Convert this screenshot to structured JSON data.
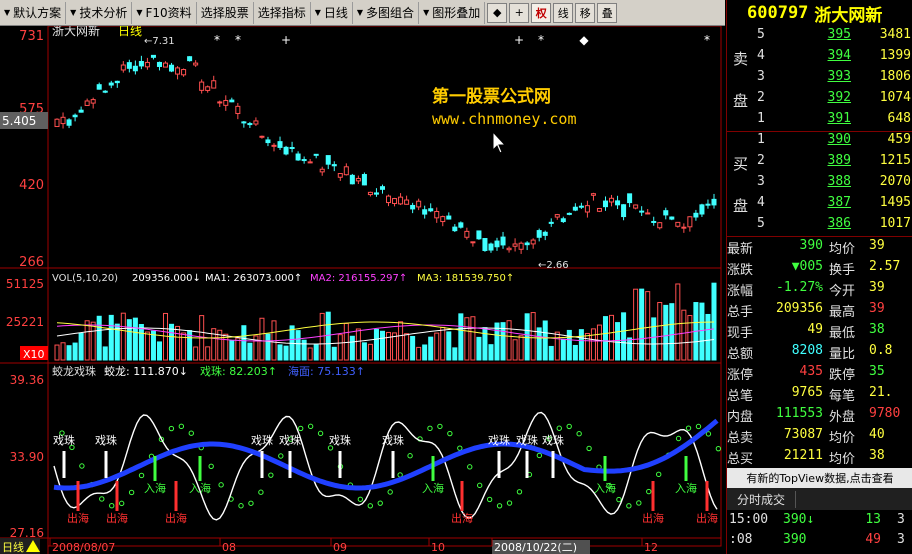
{
  "menu": {
    "items": [
      {
        "label": "默认方案",
        "arrow": "▼"
      },
      {
        "label": "技术分析",
        "arrow": "▼"
      },
      {
        "label": "F10资料",
        "arrow": "▼"
      },
      {
        "label": "选择股票",
        "arrow": ""
      },
      {
        "label": "选择指标",
        "arrow": ""
      },
      {
        "label": "日线",
        "arrow": "▼"
      },
      {
        "label": "多图组合",
        "arrow": "▼"
      },
      {
        "label": "图形叠加",
        "arrow": "▼"
      }
    ],
    "tools": [
      "◆",
      "+",
      "权",
      "线",
      "移",
      "叠"
    ]
  },
  "chart": {
    "title": "浙大网新",
    "period": "日线",
    "max_price_label": "7.31",
    "min_price_label": "2.66",
    "current_price_tag": "5.405",
    "price_axis": [
      "731",
      "575",
      "420",
      "266"
    ],
    "vol_header": {
      "label": "VOL(5,10,20)",
      "vol": "209356.000↓",
      "ma1": "MA1: 263073.000↑",
      "ma2": "MA2: 216155.297↑",
      "ma3": "MA3: 181539.750↑"
    },
    "vol_axis": [
      "51125",
      "25221",
      "X10"
    ],
    "ind_header": {
      "label": "蛟龙戏珠",
      "jl": "蛟龙: 111.870↓",
      "xz": "戏珠: 82.203↑",
      "hm": "海面: 75.133↑"
    },
    "ind_axis": [
      "39.36",
      "33.90",
      "27.16"
    ],
    "signal_labels": {
      "xizhu": "戏珠",
      "ruhai": "入海",
      "chuhai": "出海"
    },
    "date_axis": [
      "2008/08/07",
      "08",
      "09",
      "10",
      "2008/10/22(二)",
      "12"
    ],
    "period_tab": "日线"
  },
  "watermark": {
    "line1": "第一股票公式网",
    "line2": "www.chnmoney.com"
  },
  "quote": {
    "code": "600797",
    "name": "浙大网新",
    "sell_label_top": "卖",
    "sell_label_bottom": "盘",
    "buy_label_top": "买",
    "buy_label_bottom": "盘",
    "asks": [
      {
        "level": "5",
        "price": "395",
        "vol": "3481"
      },
      {
        "level": "4",
        "price": "394",
        "vol": "1399"
      },
      {
        "level": "3",
        "price": "393",
        "vol": "1806"
      },
      {
        "level": "2",
        "price": "392",
        "vol": "1074"
      },
      {
        "level": "1",
        "price": "391",
        "vol": "648"
      }
    ],
    "bids": [
      {
        "level": "1",
        "price": "390",
        "vol": "459"
      },
      {
        "level": "2",
        "price": "389",
        "vol": "1215"
      },
      {
        "level": "3",
        "price": "388",
        "vol": "2070"
      },
      {
        "level": "4",
        "price": "387",
        "vol": "1495"
      },
      {
        "level": "5",
        "price": "386",
        "vol": "1017"
      }
    ],
    "stats": [
      {
        "l1": "最新",
        "v1": "390",
        "c1": "#40ff40",
        "l2": "均价",
        "v2": "39",
        "c2": "#ffff40"
      },
      {
        "l1": "涨跌",
        "v1": "▼005",
        "c1": "#40ff40",
        "l2": "换手",
        "v2": "2.57",
        "c2": "#ffff40"
      },
      {
        "l1": "涨幅",
        "v1": "-1.27%",
        "c1": "#40ff40",
        "l2": "今开",
        "v2": "39",
        "c2": "#ffff40"
      },
      {
        "l1": "总手",
        "v1": "209356",
        "c1": "#ffff40",
        "l2": "最高",
        "v2": "39",
        "c2": "#ff4040"
      },
      {
        "l1": "现手",
        "v1": "49",
        "c1": "#ffff40",
        "l2": "最低",
        "v2": "38",
        "c2": "#40ff40"
      },
      {
        "l1": "总额",
        "v1": "8208",
        "c1": "#40ffff",
        "l2": "量比",
        "v2": "0.8",
        "c2": "#ffff40"
      },
      {
        "l1": "涨停",
        "v1": "435",
        "c1": "#ff4040",
        "l2": "跌停",
        "v2": "35",
        "c2": "#40ff40"
      },
      {
        "l1": "总笔",
        "v1": "9765",
        "c1": "#ffff40",
        "l2": "每笔",
        "v2": "21.",
        "c2": "#ffff40"
      },
      {
        "l1": "内盘",
        "v1": "111553",
        "c1": "#40ff40",
        "l2": "外盘",
        "v2": "9780",
        "c2": "#ff4040"
      },
      {
        "l1": "总卖",
        "v1": "73087",
        "c1": "#ffff40",
        "l2": "均价",
        "v2": "40",
        "c2": "#ffff40"
      },
      {
        "l1": "总买",
        "v1": "21211",
        "c1": "#ffff40",
        "l2": "均价",
        "v2": "38",
        "c2": "#ffff40"
      }
    ],
    "banner": "有新的TopView数据,点击查看",
    "tab_label": "分时成交",
    "ticks": [
      {
        "time": "15:00",
        "price": "390↓",
        "vol": "13",
        "extra": "3"
      },
      {
        "time": ":08",
        "price": "390",
        "vol": "49",
        "extra": "3"
      }
    ]
  },
  "chart_data": {
    "type": "candlestick",
    "price_range": [
      2.66,
      7.31
    ],
    "price_ticks": [
      7.31,
      5.75,
      4.2,
      2.66
    ],
    "note_max": 7.31,
    "note_min": 2.66
  }
}
